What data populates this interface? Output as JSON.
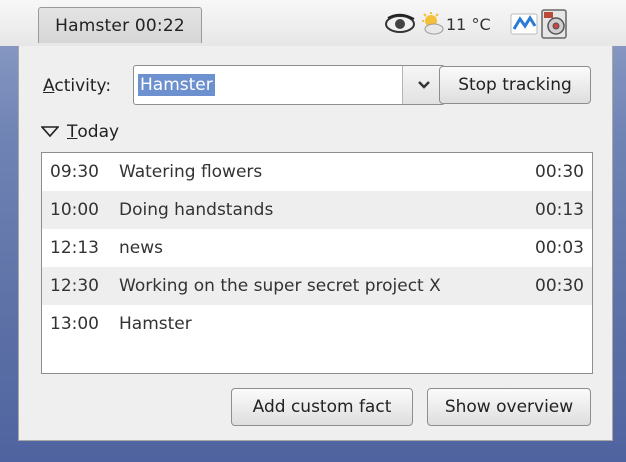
{
  "panel": {
    "applet_label": "Hamster 00:22",
    "temperature": "11 °C",
    "icons": [
      "eye-icon",
      "weather-sun-cloud-icon",
      "network-icon",
      "disk-icon"
    ]
  },
  "popup": {
    "activity_label_mnemonic": "A",
    "activity_label_rest": "ctivity:",
    "activity_value": "Hamster",
    "stop_button": "Stop tracking",
    "expander_mnemonic": "T",
    "expander_rest": "oday",
    "facts": [
      {
        "time": "09:30",
        "name": "Watering flowers",
        "duration": "00:30"
      },
      {
        "time": "10:00",
        "name": "Doing handstands",
        "duration": "00:13"
      },
      {
        "time": "12:13",
        "name": "news",
        "duration": "00:03"
      },
      {
        "time": "12:30",
        "name": "Working on the super secret project X",
        "duration": "00:30"
      },
      {
        "time": "13:00",
        "name": "Hamster",
        "duration": ""
      }
    ],
    "add_button": "Add custom fact",
    "overview_button": "Show overview"
  },
  "colors": {
    "selection": "#6d90cf",
    "panel": "#eeeeee",
    "desktop": "#5c70a6"
  }
}
